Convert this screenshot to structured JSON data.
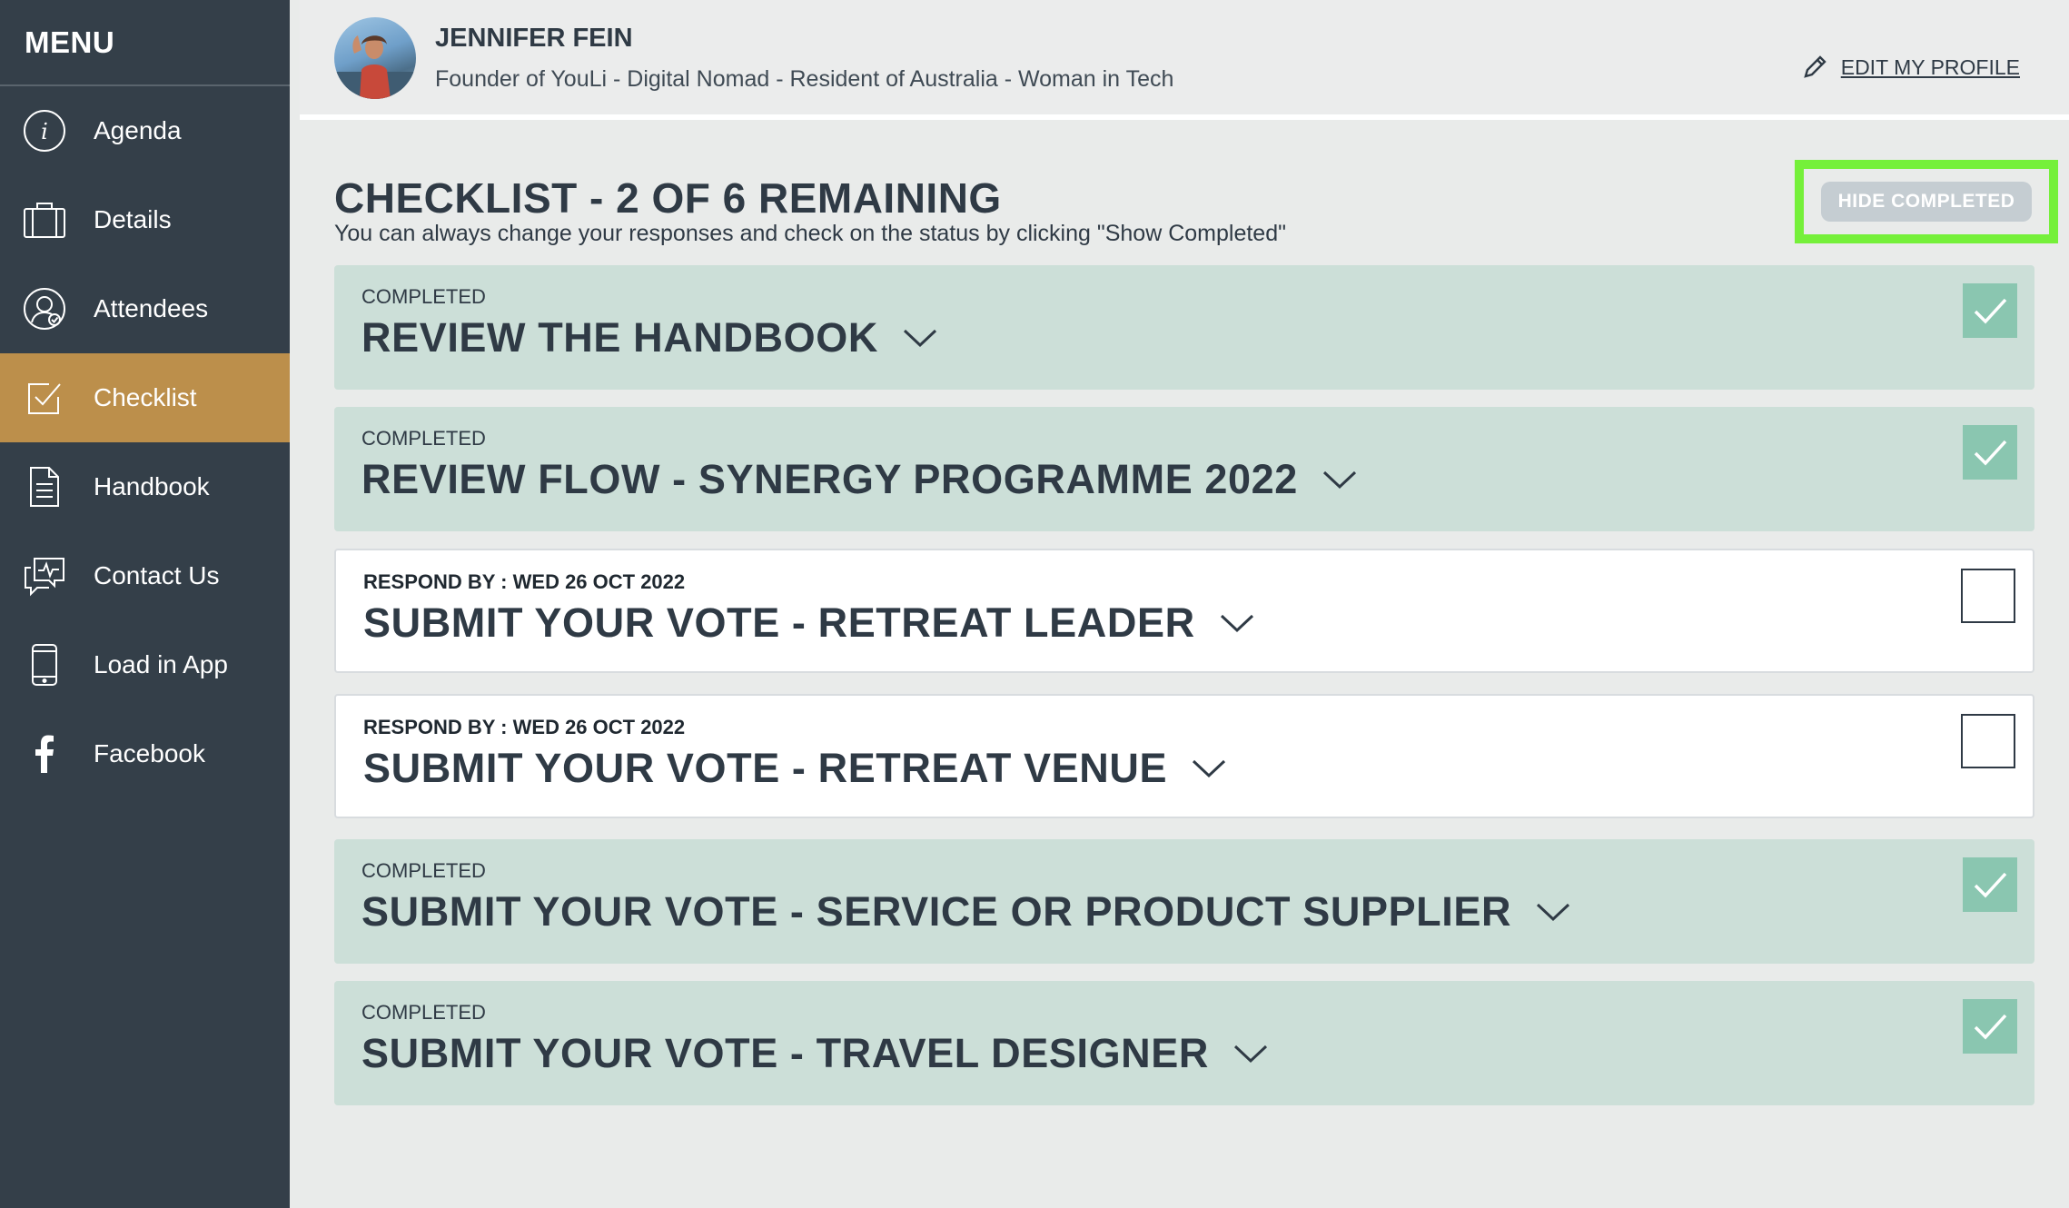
{
  "sidebar": {
    "title": "MENU",
    "items": [
      {
        "label": "Agenda",
        "icon": "info-icon"
      },
      {
        "label": "Details",
        "icon": "briefcase-icon"
      },
      {
        "label": "Attendees",
        "icon": "user-check-icon"
      },
      {
        "label": "Checklist",
        "icon": "checkbox-icon",
        "active": true
      },
      {
        "label": "Handbook",
        "icon": "document-icon"
      },
      {
        "label": "Contact Us",
        "icon": "chat-icon"
      },
      {
        "label": "Load in App",
        "icon": "phone-icon"
      },
      {
        "label": "Facebook",
        "icon": "facebook-icon"
      }
    ]
  },
  "header": {
    "name": "JENNIFER FEIN",
    "bio": "Founder of YouLi - Digital Nomad - Resident of Australia - Woman in Tech",
    "edit_label": "EDIT MY PROFILE"
  },
  "checklist": {
    "title": "CHECKLIST - 2 OF 6 REMAINING",
    "subtitle": "You can always change your responses and check on the status by clicking \"Show Completed\"",
    "hide_button": "HIDE COMPLETED",
    "tasks": [
      {
        "status_label": "COMPLETED",
        "respond_date": "",
        "title": "REVIEW THE HANDBOOK",
        "done": true
      },
      {
        "status_label": "COMPLETED",
        "respond_date": "",
        "title": "REVIEW FLOW - SYNERGY PROGRAMME 2022",
        "done": true
      },
      {
        "status_label": "RESPOND BY : ",
        "respond_date": "WED 26 OCT 2022",
        "title": "SUBMIT YOUR VOTE - RETREAT LEADER",
        "done": false
      },
      {
        "status_label": "RESPOND BY : ",
        "respond_date": "WED 26 OCT 2022",
        "title": "SUBMIT YOUR VOTE - RETREAT VENUE",
        "done": false
      },
      {
        "status_label": "COMPLETED",
        "respond_date": "",
        "title": "SUBMIT YOUR VOTE - SERVICE OR PRODUCT SUPPLIER",
        "done": true
      },
      {
        "status_label": "COMPLETED",
        "respond_date": "",
        "title": "SUBMIT YOUR VOTE - TRAVEL DESIGNER",
        "done": true
      }
    ]
  },
  "colors": {
    "sidebar_bg": "#343f49",
    "active_item": "#bc8f4b",
    "completed_bg": "#ccdfd8",
    "checked_box": "#8ac6b0",
    "highlight": "#75f03a"
  }
}
